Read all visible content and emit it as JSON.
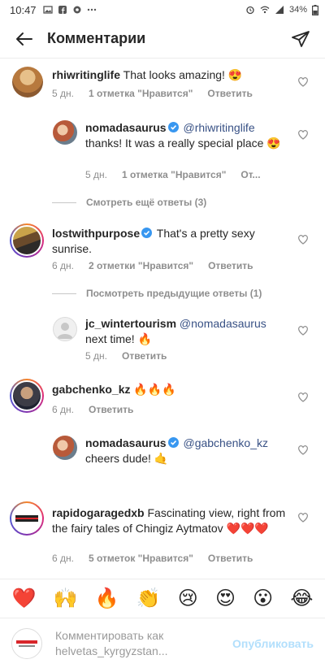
{
  "status_bar": {
    "time": "10:47",
    "battery": "34%"
  },
  "header": {
    "title": "Комментарии"
  },
  "comments": [
    {
      "username": "rhiwritinglife",
      "verified": false,
      "text": "That looks amazing! 😍",
      "mention": "",
      "time": "5 дн.",
      "likes": "1 отметка \"Нравится\"",
      "reply": "Ответить"
    },
    {
      "username": "nomadasaurus",
      "verified": true,
      "mention": "@rhiwritinglife",
      "text": "thanks! It was a really special place 😍",
      "time": "5 дн.",
      "likes": "1 отметка \"Нравится\"",
      "reply": "От..."
    },
    {
      "username": "lostwithpurpose",
      "verified": true,
      "mention": "",
      "text": "That's a pretty sexy sunrise.",
      "time": "6 дн.",
      "likes": "2 отметки \"Нравится\"",
      "reply": "Ответить"
    },
    {
      "username": "jc_wintertourism",
      "verified": false,
      "mention": "@nomadasaurus",
      "text": "next time! 🔥",
      "time": "5 дн.",
      "likes": "",
      "reply": "Ответить"
    },
    {
      "username": "gabchenko_kz",
      "verified": false,
      "mention": "",
      "text": "🔥🔥🔥",
      "time": "6 дн.",
      "likes": "",
      "reply": "Ответить"
    },
    {
      "username": "nomadasaurus",
      "verified": true,
      "mention": "@gabchenko_kz",
      "text": "cheers dude! 🤙",
      "time": "",
      "likes": "",
      "reply": ""
    },
    {
      "username": "rapidogaragedxb",
      "verified": false,
      "mention": "",
      "text": "Fascinating view, right from the fairy tales of Chingiz Aytmatov ❤️❤️❤️",
      "time": "6 дн.",
      "likes": "5 отметок \"Нравится\"",
      "reply": "Ответить"
    }
  ],
  "view_more": {
    "replies_1": "Смотреть ещё ответы (3)",
    "replies_2": "Посмотреть предыдущие ответы (1)"
  },
  "quick_emojis": [
    "❤️",
    "🙌",
    "🔥",
    "👏",
    "😢",
    "😍",
    "😮",
    "😂"
  ],
  "composer": {
    "placeholder": "Комментировать как helvetas_kyrgyzstan...",
    "placeholder_line1": "Комментировать как",
    "placeholder_line2": "helvetas_kyrgyzstan...",
    "publish": "Опубликовать"
  },
  "colors": {
    "mention": "#385185",
    "muted": "#8e8e8e",
    "publish_disabled": "#b2dffc",
    "verified": "#3897f0"
  }
}
